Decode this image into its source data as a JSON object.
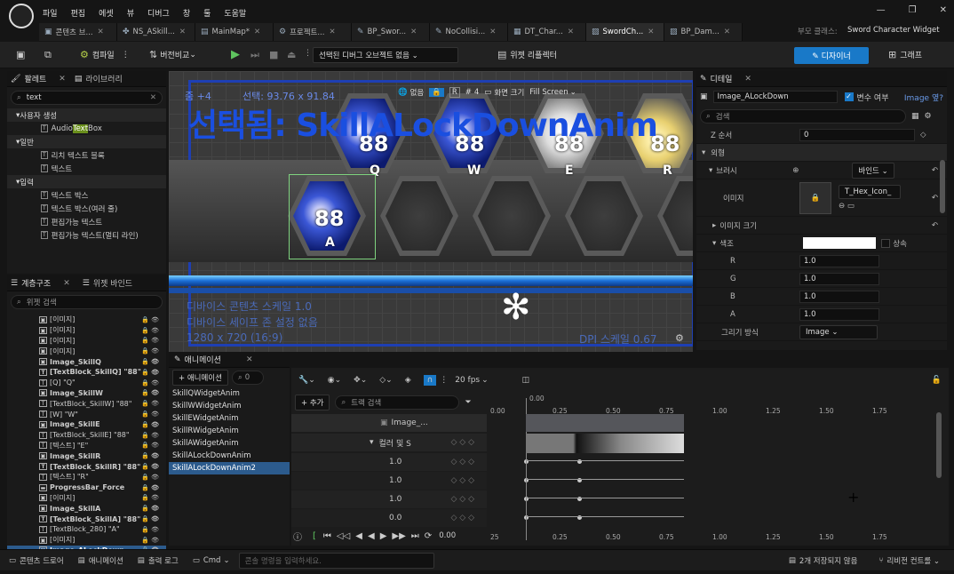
{
  "menu": [
    "파일",
    "편집",
    "에셋",
    "뷰",
    "디버그",
    "창",
    "툴",
    "도움말"
  ],
  "window_controls": [
    "—",
    "❐",
    "✕"
  ],
  "tabs": [
    {
      "label": "콘텐츠 브...",
      "icon": "▣"
    },
    {
      "label": "NS_ASkill...",
      "icon": "✤"
    },
    {
      "label": "MainMap*",
      "icon": "▤"
    },
    {
      "label": "프로젝트...",
      "icon": "⚙"
    },
    {
      "label": "BP_Swor...",
      "icon": "✎"
    },
    {
      "label": "NoCollisi...",
      "icon": "✎"
    },
    {
      "label": "DT_Char...",
      "icon": "▦"
    },
    {
      "label": "SwordCh...",
      "icon": "▨"
    },
    {
      "label": "BP_Dam...",
      "icon": "▨"
    }
  ],
  "parent_class_label": "부모 클래스:",
  "parent_class": "Sword Character Widget",
  "toolbar": {
    "compile": "컴파일",
    "diff": "버전비교",
    "debug_object": "선택된 디버그 오브젝트 없음",
    "widget_reflector": "위젯 리플렉터",
    "designer": "디자이너",
    "graph": "그래프"
  },
  "palette": {
    "tab": "팔레트",
    "tab2": "라이브러리",
    "search_value": "text",
    "sections": [
      {
        "name": "사용자 생성",
        "items": [
          {
            "pre": "Audio",
            "hl": "Text",
            "post": "Box"
          }
        ]
      },
      {
        "name": "일반",
        "items": [
          {
            "pre": "리치 텍스트 블록",
            "hl": "",
            "post": ""
          },
          {
            "pre": "텍스트",
            "hl": "",
            "post": ""
          }
        ]
      },
      {
        "name": "입력",
        "items": [
          {
            "pre": "텍스트 박스",
            "hl": "",
            "post": ""
          },
          {
            "pre": "텍스트 박스(여러 줄)",
            "hl": "",
            "post": ""
          },
          {
            "pre": "편집가능 텍스트",
            "hl": "",
            "post": ""
          },
          {
            "pre": "편집가능 텍스트(멀티 라인)",
            "hl": "",
            "post": ""
          }
        ]
      }
    ]
  },
  "hierarchy": {
    "tab": "계층구조",
    "tab2": "위젯 바인드",
    "search_placeholder": "위젯 검색",
    "items": [
      {
        "label": "[이미지]",
        "icon": "▣",
        "bold": false
      },
      {
        "label": "[이미지]",
        "icon": "▣",
        "bold": false
      },
      {
        "label": "[이미지]",
        "icon": "▣",
        "bold": false
      },
      {
        "label": "[이미지]",
        "icon": "▣",
        "bold": false
      },
      {
        "label": "Image_SkillQ",
        "icon": "▣",
        "bold": true
      },
      {
        "label": "[TextBlock_SkillQ] \"88\"",
        "icon": "T",
        "bold": true
      },
      {
        "label": "[Q] \"Q\"",
        "icon": "T",
        "bold": false
      },
      {
        "label": "Image_SkillW",
        "icon": "▣",
        "bold": true
      },
      {
        "label": "[TextBlock_SkillW] \"88\"",
        "icon": "T",
        "bold": false
      },
      {
        "label": "[W] \"W\"",
        "icon": "T",
        "bold": false
      },
      {
        "label": "Image_SkillE",
        "icon": "▣",
        "bold": true
      },
      {
        "label": "[TextBlock_SkillE] \"88\"",
        "icon": "T",
        "bold": false
      },
      {
        "label": "[텍스트] \"E\"",
        "icon": "T",
        "bold": false
      },
      {
        "label": "Image_SkillR",
        "icon": "▣",
        "bold": true
      },
      {
        "label": "[TextBlock_SkillR] \"88\"",
        "icon": "T",
        "bold": true
      },
      {
        "label": "[텍스트] \"R\"",
        "icon": "T",
        "bold": false
      },
      {
        "label": "ProgressBar_Force",
        "icon": "▬",
        "bold": true
      },
      {
        "label": "[이미지]",
        "icon": "▣",
        "bold": false
      },
      {
        "label": "Image_SkillA",
        "icon": "▣",
        "bold": true
      },
      {
        "label": "[TextBlock_SkillA] \"88\"",
        "icon": "T",
        "bold": true
      },
      {
        "label": "[TextBlock_280] \"A\"",
        "icon": "T",
        "bold": false
      },
      {
        "label": "[이미지]",
        "icon": "▣",
        "bold": false
      },
      {
        "label": "Image_ALockDown",
        "icon": "▣",
        "bold": true,
        "selected": true
      }
    ]
  },
  "viewport": {
    "zoom": "줌 +4",
    "selection_size": "선택: 93.76 x 91.84",
    "selected_label": "선택됨: SkillALockDownAnim",
    "none_label": "없음",
    "r_label": "R",
    "grid_num": "4",
    "screen_size": "화면 크기",
    "fill_screen": "Fill Screen",
    "hex_numbers": [
      "88",
      "88",
      "88",
      "88"
    ],
    "hex_keys": [
      "Q",
      "W",
      "E",
      "R"
    ],
    "a_number": "88",
    "a_key": "A",
    "info1": "디바이스 콘텐츠 스케일 1.0",
    "info2": "디바이스 세이프 존 설정 없음",
    "info3": "1280 x 720 (16:9)",
    "dpi": "DPI 스케일 0.67"
  },
  "details": {
    "tab": "디테일",
    "name": "Image_ALockDown",
    "is_variable": "변수 여부",
    "image_overflow": "Image 옆?",
    "search_placeholder": "검색",
    "z_order_label": "Z 순서",
    "z_order": "0",
    "appearance": "외형",
    "brush": "브러시",
    "bind": "바인드",
    "image_label": "이미지",
    "image_asset": "T_Hex_Icon_",
    "image_size": "이미지 크기",
    "tint": "색조",
    "tint_mode": "상속",
    "channels": [
      {
        "k": "R",
        "v": "1.0"
      },
      {
        "k": "G",
        "v": "1.0"
      },
      {
        "k": "B",
        "v": "1.0"
      },
      {
        "k": "A",
        "v": "1.0"
      }
    ],
    "draw_as_label": "그리기 방식",
    "draw_as": "Image"
  },
  "animations": {
    "tab": "애니메이션",
    "add_button": "+ 애니메이션",
    "search_value": "0",
    "list": [
      "SkillQWidgetAnim",
      "SkillWWidgetAnim",
      "SkillEWidgetAnim",
      "SkillRWidgetAnim",
      "SkillAWidgetAnim",
      "SkillALockDownAnim",
      "SkillALockDownAnim2"
    ],
    "fps": "20 fps",
    "add_track": "+ 추가",
    "track_search": "트랙 검색",
    "track_image": "Image_...",
    "track_color": "컬러 및 S",
    "track_values": [
      "1.0",
      "1.0",
      "1.0",
      "0.0"
    ],
    "time": "0.00",
    "ruler": [
      "0.00",
      "0.25",
      "0.50",
      "0.75",
      "1.00",
      "1.25",
      "1.50",
      "1.75"
    ],
    "ruler_ticks": [
      "25",
      "0.25",
      "0.50",
      "0.75",
      "1.00",
      "1.25",
      "1.50",
      "1.75"
    ]
  },
  "bottom": {
    "content_drawer": "콘텐츠 드로어",
    "animation": "애니메이션",
    "output_log": "출력 로그",
    "cmd": "Cmd",
    "cmd_placeholder": "콘솔 명령을 입력하세요.",
    "unsaved": "2개 저장되지 않음",
    "source_control": "리비전 컨트롤"
  }
}
